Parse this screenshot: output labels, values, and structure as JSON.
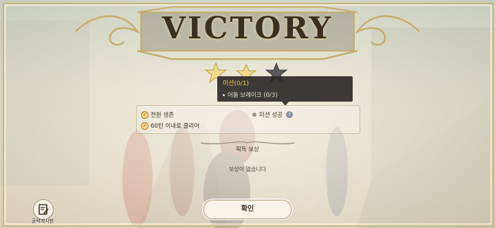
{
  "banner": {
    "title": "VICTORY"
  },
  "stars": {
    "earned": 2,
    "total": 3
  },
  "tooltip": {
    "title": "미션(0/1)",
    "item": "어둠 브레이크 (0/3)"
  },
  "missions": [
    {
      "label": "전원 생존",
      "done": true
    },
    {
      "label": "60턴 이내로 클리어",
      "done": true
    },
    {
      "label": "미션 성공",
      "done": false,
      "has_help": true,
      "help_label": "?"
    }
  ],
  "reward": {
    "label": "획득 보상",
    "empty_text": "보상이 없습니다"
  },
  "buttons": {
    "confirm": "확인",
    "board": "공략게시판"
  },
  "colors": {
    "gold": "#c9b57e",
    "star_gold": "#f2d98a",
    "star_gray": "#5a5a5a",
    "tooltip_bg": "#2d2a28",
    "tooltip_title": "#f2c552"
  }
}
